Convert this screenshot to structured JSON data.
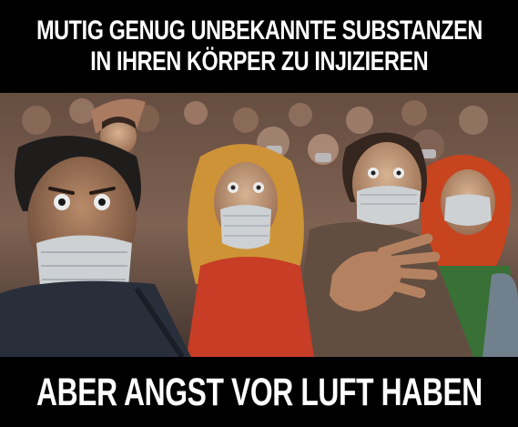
{
  "meme": {
    "top_caption_lines": [
      "MUTIG GENUG UNBEKANNTE SUBSTANZEN",
      "IN IHREN KÖRPER ZU INJIZIEREN"
    ],
    "bottom_caption": "ABER ANGST VOR LUFT HABEN"
  },
  "illustration": {
    "subject": "painted crowd of frightened people wearing surgical face masks",
    "colors": {
      "background_crowd": "#8a6b5a",
      "mask": "#dfe3e6",
      "woman_hair": "#e0a03c",
      "red_dress": "#d8432a",
      "redhead_hair": "#d84a22",
      "dark_jacket": "#2c3440"
    }
  }
}
